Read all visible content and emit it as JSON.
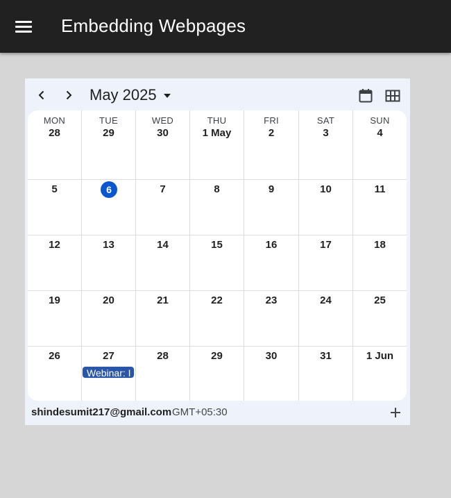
{
  "appbar": {
    "menu_icon": "hamburger-menu-icon",
    "title": "Embedding Webpages"
  },
  "calendar": {
    "month_label": "May 2025",
    "icons": {
      "prev": "chevron-left-icon",
      "next": "chevron-right-icon",
      "month_dropdown": "caret-down-icon",
      "month_view": "calendar-icon",
      "grid_view": "grid-icon",
      "add": "plus-icon"
    },
    "weekdays": [
      "MON",
      "TUE",
      "WED",
      "THU",
      "FRI",
      "SAT",
      "SUN"
    ],
    "weeks": [
      [
        "28",
        "29",
        "30",
        "1 May",
        "2",
        "3",
        "4"
      ],
      [
        "5",
        "6",
        "7",
        "8",
        "9",
        "10",
        "11"
      ],
      [
        "12",
        "13",
        "14",
        "15",
        "16",
        "17",
        "18"
      ],
      [
        "19",
        "20",
        "21",
        "22",
        "23",
        "24",
        "25"
      ],
      [
        "26",
        "27",
        "28",
        "29",
        "30",
        "31",
        "1 Jun"
      ]
    ],
    "today": "6",
    "event": {
      "label": "Webinar: I",
      "day": "27",
      "color": "#2a56a8"
    },
    "colors": {
      "accent": "#0b57d0",
      "frame": "#eef2fb",
      "appbar": "#212121"
    },
    "footer": {
      "account": "shindesumit217@gmail.com",
      "timezone": "GMT+05:30"
    }
  }
}
